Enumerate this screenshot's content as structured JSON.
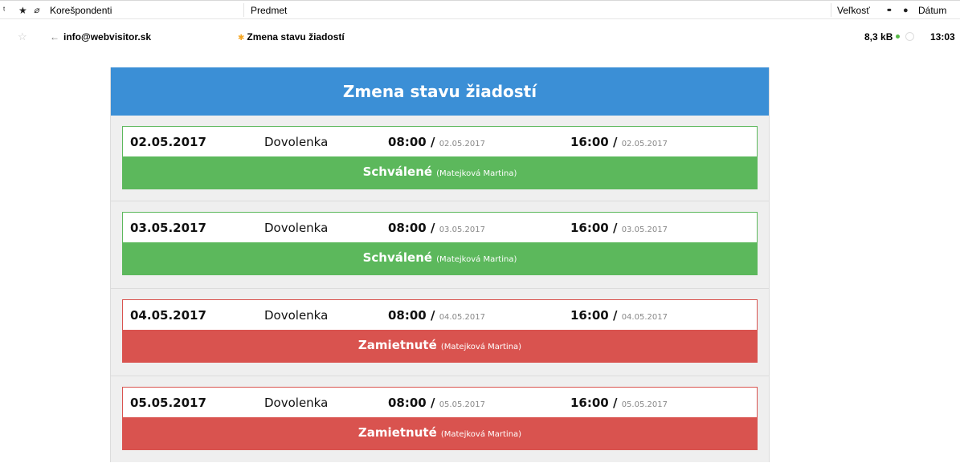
{
  "header": {
    "thread_icon": "ᵗ",
    "star_icon": "★",
    "attach_icon": "⌀",
    "correspondents": "Korešpondenti",
    "subject": "Predmet",
    "size": "Veľkosť",
    "read_icon": "••",
    "junk_icon": "●",
    "date": "Dátum"
  },
  "message": {
    "star_icon": "☆",
    "reply_icon": "←",
    "from": "info@webvisitor.sk",
    "new_icon": "✱",
    "subject": "Zmena stavu žiadostí",
    "size": "8,3 kB",
    "time": "13:03"
  },
  "email": {
    "title": "Zmena stavu žiadostí",
    "requests": [
      {
        "date": "02.05.2017",
        "type": "Dovolenka",
        "from_time": "08:00",
        "from_date": "02.05.2017",
        "to_time": "16:00",
        "to_date": "02.05.2017",
        "status": "Schválené",
        "approver": "(Matejková Martina)",
        "state": "approved"
      },
      {
        "date": "03.05.2017",
        "type": "Dovolenka",
        "from_time": "08:00",
        "from_date": "03.05.2017",
        "to_time": "16:00",
        "to_date": "03.05.2017",
        "status": "Schválené",
        "approver": "(Matejková Martina)",
        "state": "approved"
      },
      {
        "date": "04.05.2017",
        "type": "Dovolenka",
        "from_time": "08:00",
        "from_date": "04.05.2017",
        "to_time": "16:00",
        "to_date": "04.05.2017",
        "status": "Zamietnuté",
        "approver": "(Matejková Martina)",
        "state": "rejected"
      },
      {
        "date": "05.05.2017",
        "type": "Dovolenka",
        "from_time": "08:00",
        "from_date": "05.05.2017",
        "to_time": "16:00",
        "to_date": "05.05.2017",
        "status": "Zamietnuté",
        "approver": "(Matejková Martina)",
        "state": "rejected"
      }
    ]
  },
  "colors": {
    "header_blue": "#3b8fd6",
    "approved_green": "#5cb85c",
    "rejected_red": "#d9534f"
  }
}
